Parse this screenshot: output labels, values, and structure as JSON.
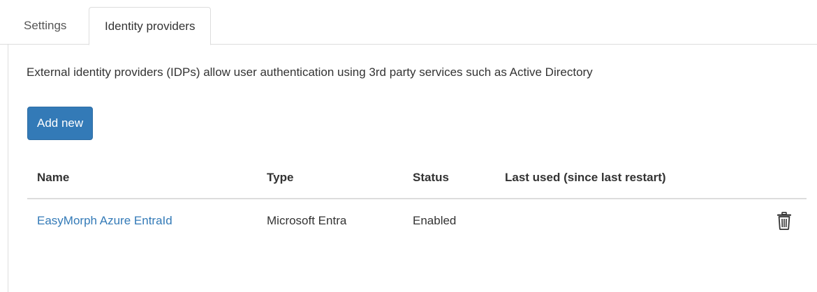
{
  "tabs": [
    {
      "label": "Settings",
      "active": false
    },
    {
      "label": "Identity providers",
      "active": true
    }
  ],
  "panel": {
    "description": "External identity providers (IDPs) allow user authentication using 3rd party services such as Active Directory",
    "add_button_label": "Add new"
  },
  "table": {
    "headers": {
      "name": "Name",
      "type": "Type",
      "status": "Status",
      "last_used": "Last used (since last restart)"
    },
    "rows": [
      {
        "name": "EasyMorph Azure EntraId",
        "type": "Microsoft Entra",
        "status": "Enabled",
        "last_used": ""
      }
    ]
  },
  "icons": {
    "delete": "trash-icon"
  },
  "colors": {
    "primary": "#337ab7",
    "link": "#337ab7",
    "border": "#dddddd",
    "text": "#333333"
  }
}
